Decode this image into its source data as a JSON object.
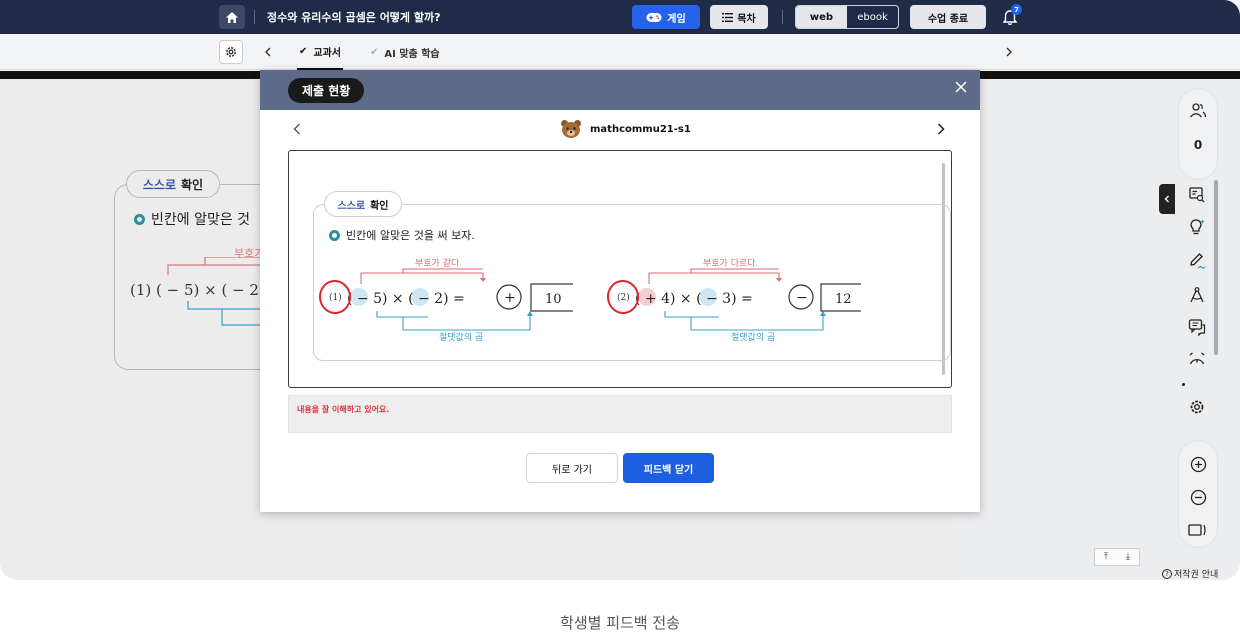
{
  "topbar": {
    "lesson_title": "정수와 유리수의 곱셈은 어떻게 할까?",
    "game_label": "게임",
    "toc_label": "목차",
    "mode_web": "web",
    "mode_ebook": "ebook",
    "end_class_label": "수업 종료",
    "notification_count": "7"
  },
  "tabs": {
    "textbook": "교과서",
    "ai": "AI 맞춤 학습"
  },
  "background": {
    "badge_word": "스스로",
    "badge_label": "확인",
    "instruction": "빈칸에 알맞은 것",
    "expression": "(1) ( − 5) × ( − 2",
    "hint": "부호가"
  },
  "rail": {
    "student_count": "0"
  },
  "modal": {
    "title": "제출 현황",
    "student_id": "mathcommu21-s1",
    "card_badge_word": "스스로",
    "card_badge_label": "확인",
    "instruction": "빈칸에 알맞은 것을 써 보자.",
    "problem1": {
      "label": "(1)",
      "expr": "( − 5) × ( − 2) =",
      "sign": "+",
      "answer": "10",
      "hint_top": "부호가 같다.",
      "hint_bottom": "절댓값의 곱"
    },
    "problem2": {
      "label": "(2)",
      "expr": "( + 4) × ( − 3) =",
      "sign": "−",
      "answer": "12",
      "hint_top": "부호가 다르다.",
      "hint_bottom": "절댓값의 곱"
    },
    "feedback": "내용을 잘 이해하고 있어요.",
    "back_label": "뒤로 가기",
    "close_label": "피드백 닫기"
  },
  "footer": {
    "copyright": "저작권 안내",
    "caption": "학생별 피드백 전송"
  },
  "colors": {
    "nav_dark": "#1f2b47",
    "accent_blue": "#2563eb",
    "hint_red": "#d9787d",
    "hint_blue": "#3aa0c8",
    "feedback_red": "#e5303a"
  }
}
